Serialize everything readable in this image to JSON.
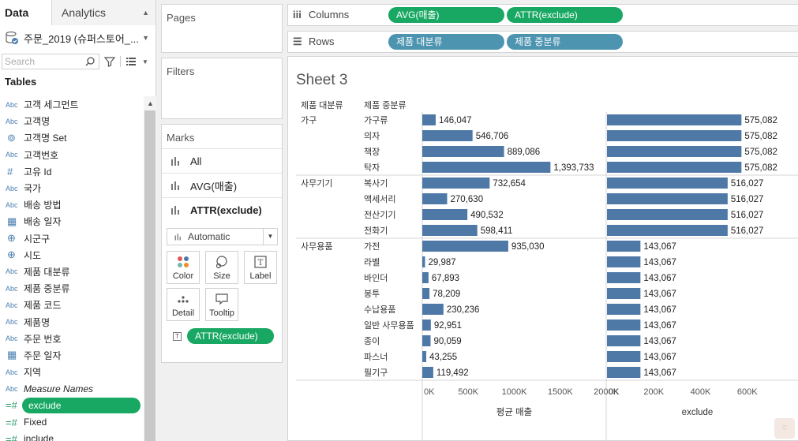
{
  "data_pane": {
    "tab_data": "Data",
    "tab_analytics": "Analytics",
    "datasource_name": "주문_2019 (슈퍼스토어_...",
    "search_placeholder": "Search",
    "tables_heading": "Tables",
    "fields": [
      {
        "type": "Abc",
        "name": "고객 세그먼트"
      },
      {
        "type": "Abc",
        "name": "고객명"
      },
      {
        "type": "set",
        "name": "고객명 Set"
      },
      {
        "type": "Abc",
        "name": "고객번호"
      },
      {
        "type": "#",
        "name": "고유 Id"
      },
      {
        "type": "Abc",
        "name": "국가"
      },
      {
        "type": "Abc",
        "name": "배송 방법"
      },
      {
        "type": "date",
        "name": "배송 일자"
      },
      {
        "type": "geo",
        "name": "시군구"
      },
      {
        "type": "geo",
        "name": "시도"
      },
      {
        "type": "Abc",
        "name": "제품 대분류"
      },
      {
        "type": "Abc",
        "name": "제품 중분류"
      },
      {
        "type": "Abc",
        "name": "제품 코드"
      },
      {
        "type": "Abc",
        "name": "제품명"
      },
      {
        "type": "Abc",
        "name": "주문 번호"
      },
      {
        "type": "date",
        "name": "주문 일자"
      },
      {
        "type": "Abc",
        "name": "지역"
      },
      {
        "type": "Abc",
        "name": "Measure Names",
        "italic": true
      },
      {
        "type": "=#",
        "name": "exclude",
        "selected": true
      },
      {
        "type": "=#",
        "name": "Fixed"
      },
      {
        "type": "=#",
        "name": "include"
      }
    ]
  },
  "cards": {
    "pages": "Pages",
    "filters": "Filters",
    "marks": "Marks",
    "marks_rows": [
      "All",
      "AVG(매출)",
      "ATTR(exclude)"
    ],
    "mark_type": "Automatic",
    "buttons": [
      "Color",
      "Size",
      "Label",
      "Detail",
      "Tooltip"
    ],
    "marks_pill": "ATTR(exclude)"
  },
  "shelves": {
    "columns_label": "Columns",
    "rows_label": "Rows",
    "columns_pills": [
      "AVG(매출)",
      "ATTR(exclude)"
    ],
    "rows_pills": [
      "제품 대분류",
      "제품 중분류"
    ]
  },
  "colors": {
    "bar": "#4e79a7",
    "pill_green": "#18a863",
    "pill_blue": "#4d94b0"
  },
  "chart_data": {
    "type": "bar",
    "title": "Sheet 3",
    "row_headers": [
      "제품 대분류",
      "제품 중분류"
    ],
    "groups": [
      {
        "name": "가구",
        "subcategories": [
          "가구류",
          "의자",
          "책장",
          "탁자"
        ]
      },
      {
        "name": "사무기기",
        "subcategories": [
          "복사기",
          "액세서리",
          "전산기기",
          "전화기"
        ]
      },
      {
        "name": "사무용품",
        "subcategories": [
          "가전",
          "라벨",
          "바인더",
          "봉투",
          "수납용품",
          "일반 사무용품",
          "종이",
          "파스너",
          "필기구"
        ]
      }
    ],
    "series": [
      {
        "name": "평균 매출",
        "values": [
          146047,
          546706,
          889086,
          1393733,
          732654,
          270630,
          490532,
          598411,
          935030,
          29987,
          67893,
          78209,
          230236,
          92951,
          90059,
          43255,
          119492
        ],
        "labels": [
          "146,047",
          "546,706",
          "889,086",
          "1,393,733",
          "732,654",
          "270,630",
          "490,532",
          "598,411",
          "935,030",
          "29,987",
          "67,893",
          "78,209",
          "230,236",
          "92,951",
          "90,059",
          "43,255",
          "119,492"
        ],
        "xlim": [
          0,
          2000000
        ],
        "ticks": [
          "0K",
          "500K",
          "1000K",
          "1500K",
          "2000K"
        ]
      },
      {
        "name": "exclude",
        "values": [
          575082,
          575082,
          575082,
          575082,
          516027,
          516027,
          516027,
          516027,
          143067,
          143067,
          143067,
          143067,
          143067,
          143067,
          143067,
          143067,
          143067
        ],
        "labels": [
          "575,082",
          "575,082",
          "575,082",
          "575,082",
          "516,027",
          "516,027",
          "516,027",
          "516,027",
          "143,067",
          "143,067",
          "143,067",
          "143,067",
          "143,067",
          "143,067",
          "143,067",
          "143,067",
          "143,067"
        ],
        "xlim": [
          0,
          800000
        ],
        "ticks": [
          "0K",
          "200K",
          "400K",
          "600K"
        ]
      }
    ]
  }
}
